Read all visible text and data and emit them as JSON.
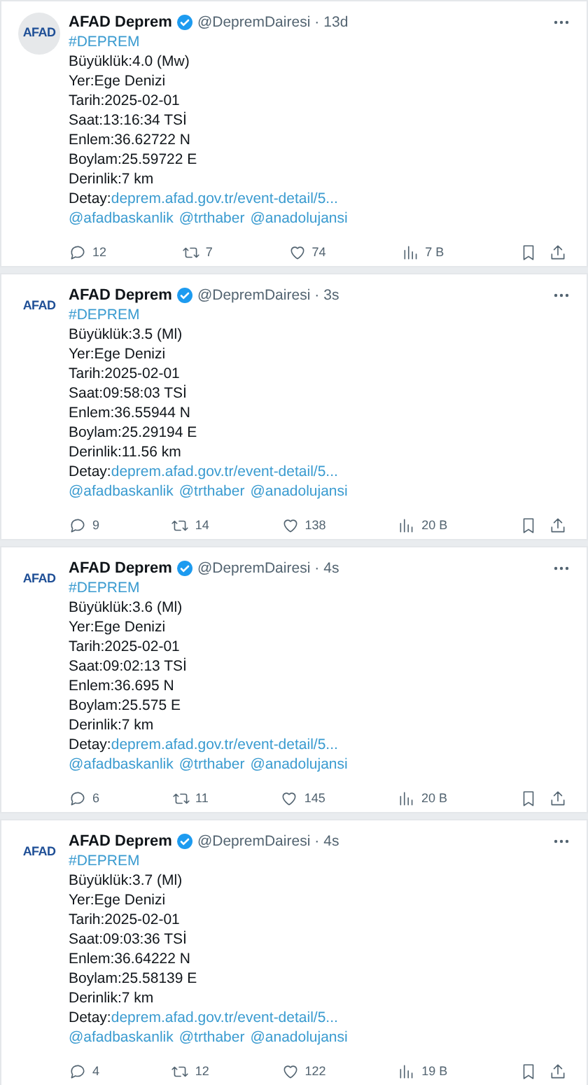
{
  "tweets": [
    {
      "avatar_text": "AFAD",
      "avatar_shaded": true,
      "author": "AFAD Deprem",
      "handle": "@DepremDairesi",
      "dot": "·",
      "time": "13d",
      "hashtag": "#DEPREM",
      "lines": [
        "Büyüklük:4.0 (Mw)",
        "Yer:Ege Denizi",
        "Tarih:2025-02-01",
        "Saat:13:16:34 TSİ",
        "Enlem:36.62722 N",
        "Boylam:25.59722 E",
        "Derinlik:7 km"
      ],
      "detail_label": "Detay:",
      "detail_link": "deprem.afad.gov.tr/event-detail/5...",
      "mentions": [
        "@afadbaskanlik",
        "@trthaber",
        "@anadolujansi"
      ],
      "replies": "12",
      "reposts": "7",
      "likes": "74",
      "views": "7 B"
    },
    {
      "avatar_text": "AFAD",
      "avatar_shaded": false,
      "author": "AFAD Deprem",
      "handle": "@DepremDairesi",
      "dot": "·",
      "time": "3s",
      "hashtag": "#DEPREM",
      "lines": [
        "Büyüklük:3.5 (Ml)",
        "Yer:Ege Denizi",
        "Tarih:2025-02-01",
        "Saat:09:58:03 TSİ",
        "Enlem:36.55944 N",
        "Boylam:25.29194 E",
        "Derinlik:11.56 km"
      ],
      "detail_label": "Detay:",
      "detail_link": "deprem.afad.gov.tr/event-detail/5...",
      "mentions": [
        "@afadbaskanlik",
        "@trthaber",
        "@anadolujansi"
      ],
      "replies": "9",
      "reposts": "14",
      "likes": "138",
      "views": "20 B"
    },
    {
      "avatar_text": "AFAD",
      "avatar_shaded": false,
      "author": "AFAD Deprem",
      "handle": "@DepremDairesi",
      "dot": "·",
      "time": "4s",
      "hashtag": "#DEPREM",
      "lines": [
        "Büyüklük:3.6 (Ml)",
        "Yer:Ege Denizi",
        "Tarih:2025-02-01",
        "Saat:09:02:13 TSİ",
        "Enlem:36.695 N",
        "Boylam:25.575 E",
        "Derinlik:7 km"
      ],
      "detail_label": "Detay:",
      "detail_link": "deprem.afad.gov.tr/event-detail/5...",
      "mentions": [
        "@afadbaskanlik",
        "@trthaber",
        "@anadolujansi"
      ],
      "replies": "6",
      "reposts": "11",
      "likes": "145",
      "views": "20 B"
    },
    {
      "avatar_text": "AFAD",
      "avatar_shaded": false,
      "author": "AFAD Deprem",
      "handle": "@DepremDairesi",
      "dot": "·",
      "time": "4s",
      "hashtag": "#DEPREM",
      "lines": [
        "Büyüklük:3.7 (Ml)",
        "Yer:Ege Denizi",
        "Tarih:2025-02-01",
        "Saat:09:03:36 TSİ",
        "Enlem:36.64222 N",
        "Boylam:25.58139 E",
        "Derinlik:7 km"
      ],
      "detail_label": "Detay:",
      "detail_link": "deprem.afad.gov.tr/event-detail/5...",
      "mentions": [
        "@afadbaskanlik",
        "@trthaber",
        "@anadolujansi"
      ],
      "replies": "4",
      "reposts": "12",
      "likes": "122",
      "views": "19 B"
    }
  ]
}
